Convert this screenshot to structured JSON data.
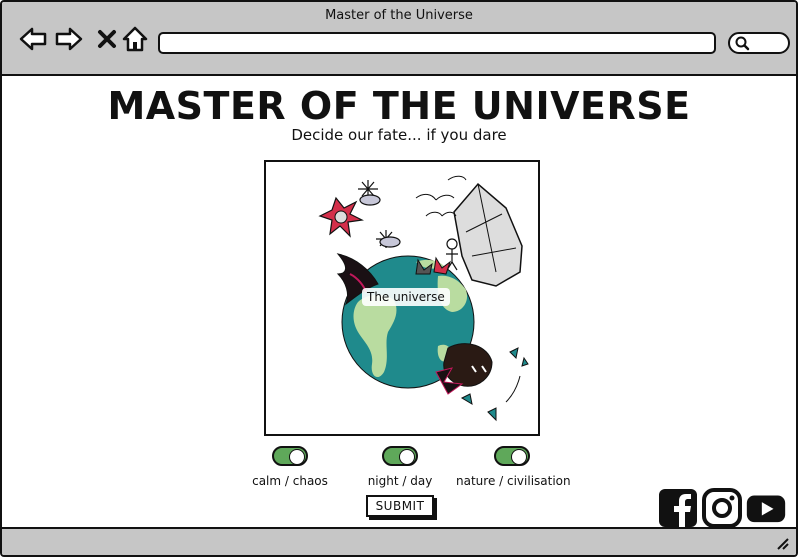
{
  "window": {
    "title": "Master of the Universe"
  },
  "page": {
    "heading": "MASTER OF THE UNIVERSE",
    "subheading": "Decide our fate... if you dare"
  },
  "image": {
    "label": "The universe"
  },
  "toggles": [
    {
      "label": "calm / chaos",
      "state": "on"
    },
    {
      "label": "night / day",
      "state": "on"
    },
    {
      "label": "nature / civilisation",
      "state": "on"
    }
  ],
  "submit_label": "SUBMIT",
  "social": [
    "facebook-icon",
    "instagram-icon",
    "youtube-icon"
  ],
  "colors": {
    "toggle_on": "#5fa85a",
    "ocean": "#1f8a8c",
    "land": "#b9dca0",
    "chrome": "#c6c6c6"
  }
}
